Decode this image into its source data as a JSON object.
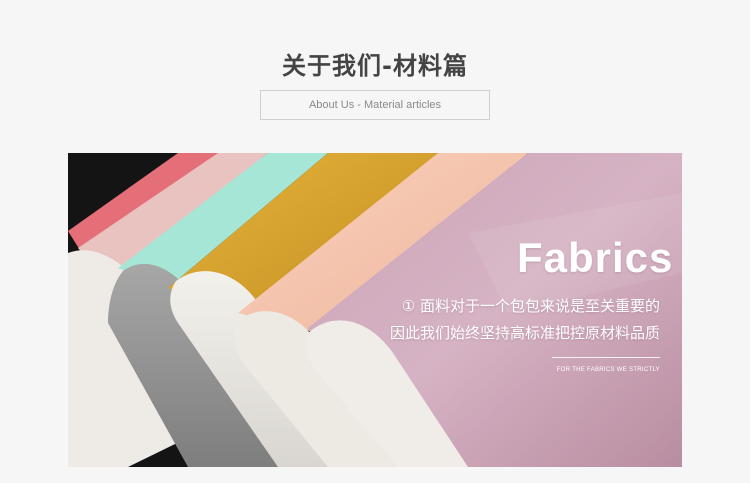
{
  "header": {
    "title": "关于我们-材料篇",
    "subtitle": "About Us - Material articles"
  },
  "banner": {
    "headline": "Fabrics",
    "line1": "① 面料对于一个包包来说是至关重要的",
    "line2": "因此我们始终坚持高标准把控原材料品质",
    "tagline": "FOR THE FABRICS WE STRICTLY",
    "swatch_colors": [
      "#e46f78",
      "#e9c3bf",
      "#a5e6d6",
      "#dba431",
      "#f5c4ad",
      "#d9aec2"
    ]
  }
}
